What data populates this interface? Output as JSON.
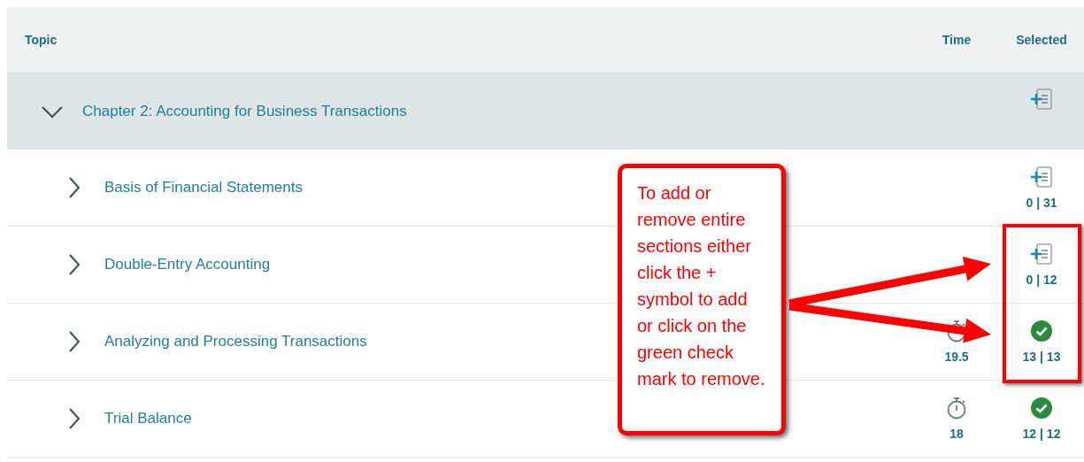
{
  "table": {
    "columns": [
      "Topic",
      "Time",
      "Selected"
    ],
    "chapter": {
      "title": "Chapter 2: Accounting for Business Transactions",
      "expanded": true,
      "all_selected": false
    },
    "rows": [
      {
        "title": "Basis of Financial Statements",
        "expanded": false,
        "all_selected": false,
        "selected_count": "0 | 31"
      },
      {
        "title": "Double-Entry Accounting",
        "expanded": false,
        "all_selected": false,
        "selected_count": "0 | 12"
      },
      {
        "title": "Analyzing and Processing Transactions",
        "expanded": false,
        "time": "19.5",
        "all_selected": true,
        "selected_count": "13 | 13"
      },
      {
        "title": "Trial Balance",
        "expanded": false,
        "time": "18",
        "all_selected": true,
        "selected_count": "12 | 12"
      }
    ]
  },
  "callout": {
    "text": "To add or remove entire sections either click the + symbol to add or click on the green check mark to remove."
  }
}
